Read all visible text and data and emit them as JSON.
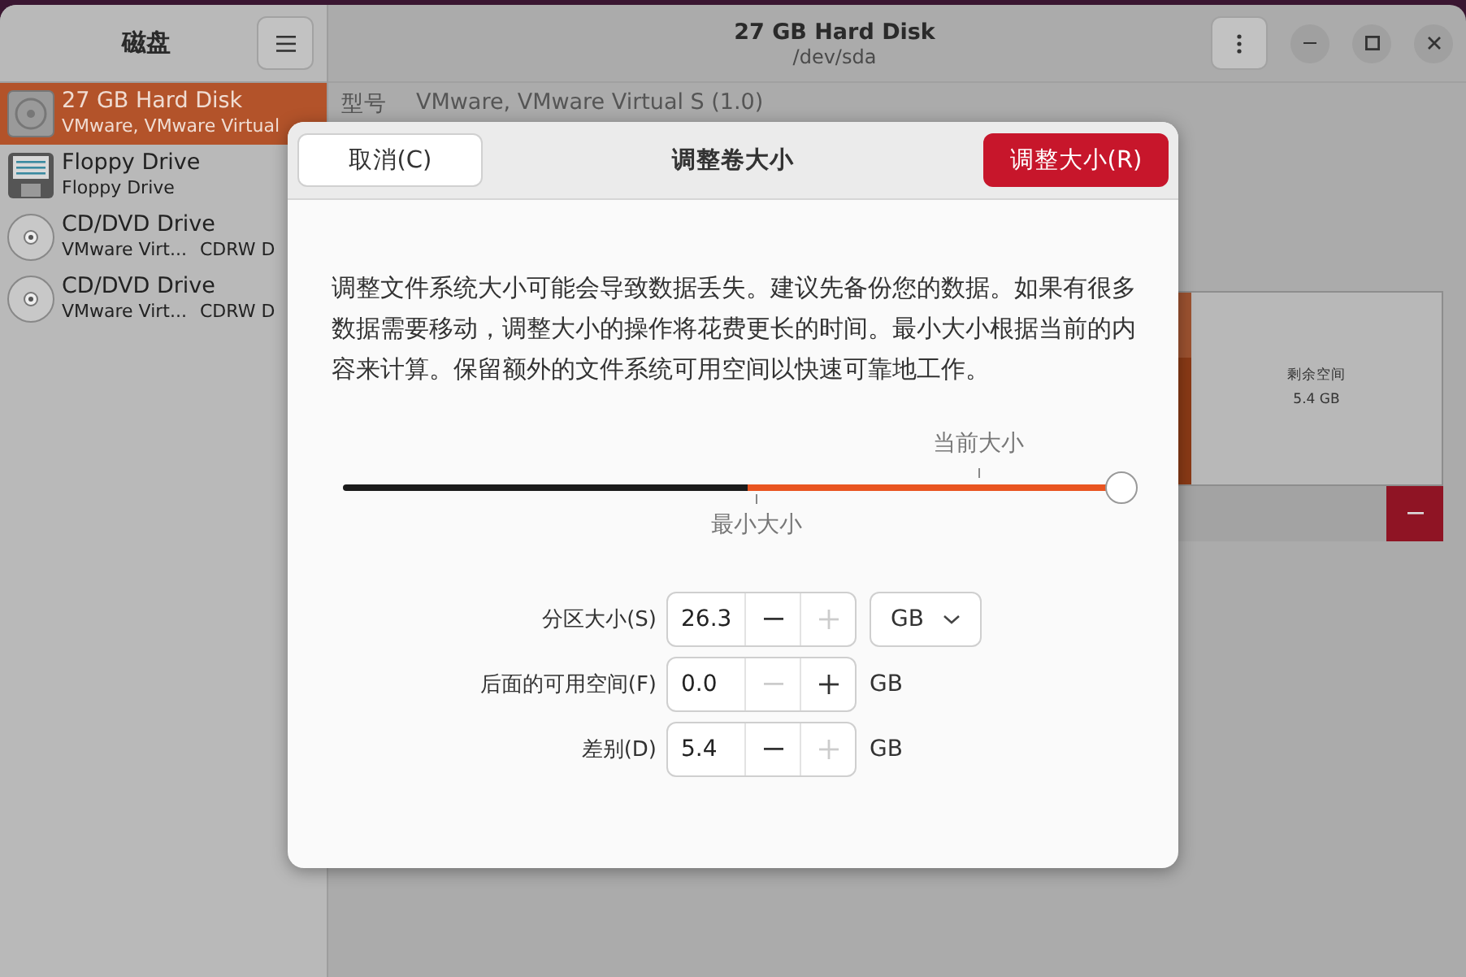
{
  "sidebar": {
    "title": "磁盘",
    "items": [
      {
        "kind": "harddisk",
        "name": "27 GB Hard Disk",
        "detail": "VMware, VMware Virtual",
        "selected": true
      },
      {
        "kind": "floppy",
        "name": "Floppy Drive",
        "detail": "Floppy Drive",
        "selected": false
      },
      {
        "kind": "optical",
        "name": "CD/DVD Drive",
        "detail": "VMware Virt...",
        "extra": "CDRW D",
        "selected": false
      },
      {
        "kind": "optical",
        "name": "CD/DVD Drive",
        "detail": "VMware Virt...",
        "extra": "CDRW D",
        "selected": false
      }
    ]
  },
  "header": {
    "title": "27 GB Hard Disk",
    "subtitle": "/dev/sda"
  },
  "details": {
    "label": "型号",
    "value": "VMware, VMware Virtual S (1.0)"
  },
  "partition_map": {
    "free_label": "剩余空间",
    "free_size": "5.4 GB"
  },
  "dialog": {
    "title": "调整卷大小",
    "cancel": "取消(C)",
    "confirm": "调整大小(R)",
    "message": "调整文件系统大小可能会导致数据丢失。建议先备份您的数据。如果有很多数据需要移动，调整大小的操作将花费更长的时间。最小大小根据当前的内容来计算。保留额外的文件系统可用空间以快速可靠地工作。",
    "slider": {
      "level": 1,
      "current_label": "当前大小",
      "min_label": "最小大小"
    },
    "fields": [
      {
        "label": "分区大小(S)",
        "value": "26.3",
        "minus_disabled": false,
        "plus_disabled": true,
        "kind": "dropdown",
        "unit": "GB"
      },
      {
        "label": "后面的可用空间(F)",
        "value": "0.0",
        "minus_disabled": true,
        "plus_disabled": false,
        "kind": "text",
        "unit": "GB"
      },
      {
        "label": "差别(D)",
        "value": "5.4",
        "minus_disabled": false,
        "plus_disabled": true,
        "kind": "text",
        "unit": "GB"
      }
    ]
  }
}
